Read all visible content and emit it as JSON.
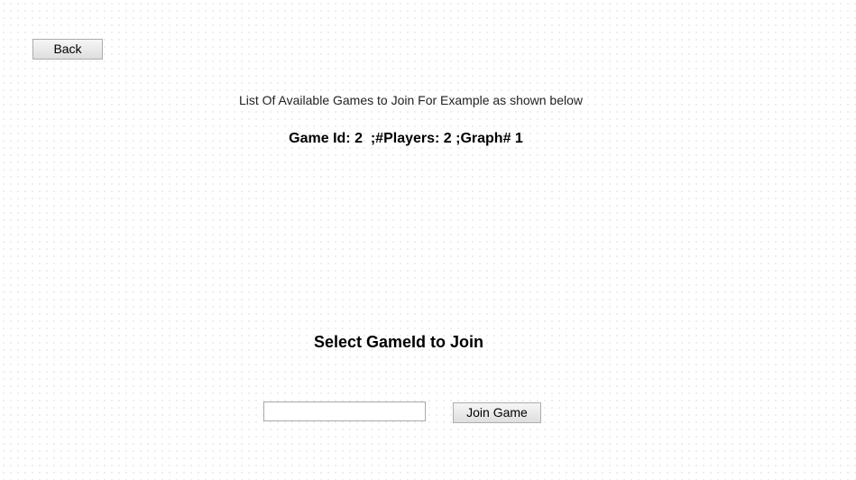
{
  "nav": {
    "back_label": "Back"
  },
  "games_list": {
    "caption": "List Of Available Games to Join For Example as shown below",
    "entries": [
      "Game Id: 2  ;#Players: 2 ;Graph# 1"
    ]
  },
  "join_form": {
    "heading": "Select GameId to Join",
    "gameid_input": {
      "value": "",
      "placeholder": ""
    },
    "join_label": "Join Game"
  }
}
